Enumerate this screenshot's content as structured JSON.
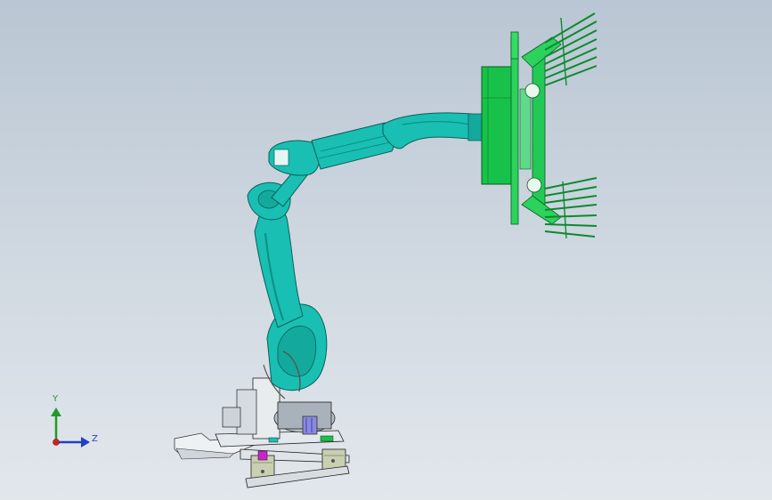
{
  "viewport": {
    "background_top": "#b9c6d3",
    "background_bottom": "#e2e7ec"
  },
  "model": {
    "arm_color": "#19bfb2",
    "arm_shadow": "#0d8e86",
    "gripper_color": "#18c24a",
    "gripper_shadow": "#0b8a2f",
    "base_color": "#e8edf1",
    "accent_magenta": "#cc22cc",
    "accent_blue": "#3a3ad8"
  },
  "triad": {
    "y_label": "Y",
    "z_label": "Z",
    "y_color": "#1f9a2a",
    "z_color": "#2241c8",
    "origin_color": "#d42020"
  }
}
